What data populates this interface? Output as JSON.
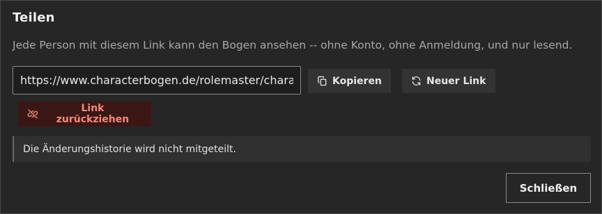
{
  "dialog": {
    "title": "Teilen",
    "description": "Jede Person mit diesem Link kann den Bogen ansehen -- ohne Konto, ohne Anmeldung, und nur lesend.",
    "share_link": "https://www.characterbogen.de/rolemaster/chara",
    "copy_label": "Kopieren",
    "new_link_label": "Neuer Link",
    "revoke_label": "Link zurückziehen",
    "notice": "Die Änderungshistorie wird nicht mitgeteilt.",
    "close_label": "Schließen"
  },
  "icons": {
    "copy": "copy-icon",
    "refresh": "refresh-icon",
    "unlink": "link-off-icon"
  },
  "colors": {
    "background": "#262626",
    "revoke_bg": "#3a1714",
    "revoke_text": "#f08a7e"
  }
}
